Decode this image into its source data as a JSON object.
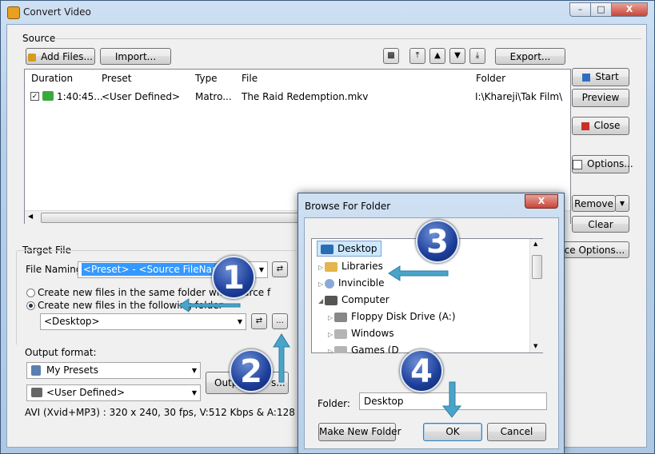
{
  "window": {
    "title": "Convert Video"
  },
  "source": {
    "label": "Source",
    "add_files": "Add Files...",
    "import": "Import...",
    "export": "Export...",
    "columns": [
      "Duration",
      "Preset",
      "Type",
      "File",
      "Folder"
    ],
    "row": {
      "duration": "1:40:45...",
      "preset": "<User Defined>",
      "type": "Matro...",
      "file": "The Raid Redemption.mkv",
      "folder": "I:\\Khareji\\Tak Film\\"
    }
  },
  "side_buttons": {
    "start": "Start",
    "preview": "Preview",
    "close": "Close",
    "options": "Options...",
    "remove": "Remove",
    "clear": "Clear",
    "source_options": "rce Options..."
  },
  "target": {
    "label": "Target File",
    "naming_label": "File Naming:",
    "naming_value": "<Preset> - <Source FileName>",
    "radio_same": "Create new files in the same folder with source f",
    "radio_following": "Create new files in the following folder",
    "folder_value": "<Desktop>",
    "browse": "...",
    "output_format_label": "Output format:",
    "presets": "My Presets",
    "user_defined": "<User Defined>",
    "output_btn": "Outp",
    "output_btn_tail": "s...",
    "summary": "AVI (Xvid+MP3) : 320 x 240, 30 fps, V:512 Kbps & A:128 Kbps"
  },
  "dialog": {
    "title": "Browse For Folder",
    "tree": [
      "Desktop",
      "Libraries",
      "Invincible",
      "Computer",
      "Floppy Disk Drive (A:)",
      "Windows",
      "Games (D"
    ],
    "folder_label": "Folder:",
    "folder_value": "Desktop",
    "make_new": "Make New Folder",
    "ok": "OK",
    "cancel": "Cancel"
  },
  "badges": [
    "1",
    "2",
    "3",
    "4"
  ],
  "colors": {
    "accent_arrow": "#4aa3c9",
    "badge": "#1d3f9a",
    "selection": "#3399ff"
  }
}
